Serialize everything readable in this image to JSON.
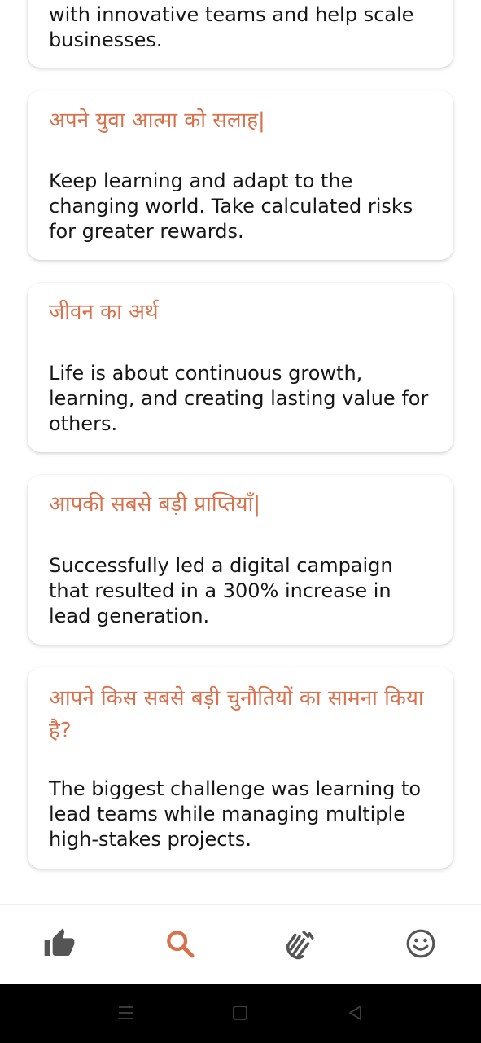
{
  "cards": [
    {
      "title": "",
      "body": "with innovative teams and help scale businesses."
    },
    {
      "title": "अपने युवा आत्मा को सलाह|",
      "body": "Keep learning and adapt to the changing world. Take calculated risks for greater rewards."
    },
    {
      "title": "जीवन का अर्थ",
      "body": "Life is about continuous growth, learning, and creating lasting value for others."
    },
    {
      "title": "आपकी सबसे बड़ी प्राप्तियाँ|",
      "body": "Successfully led a digital campaign that resulted in a 300% increase in lead generation."
    },
    {
      "title": "आपने किस सबसे बड़ी चुनौतियों का सामना किया है?",
      "body": "The biggest challenge was learning to lead teams while managing multiple high-stakes projects."
    }
  ],
  "nav": {
    "items": [
      {
        "icon": "thumbs-up-icon",
        "active": false
      },
      {
        "icon": "search-icon",
        "active": true
      },
      {
        "icon": "clapping-hands-icon",
        "active": false
      },
      {
        "icon": "smiley-face-icon",
        "active": false
      }
    ],
    "active_color": "#d9714d",
    "inactive_color": "#555555"
  },
  "colors": {
    "title": "#d9714d",
    "body": "#161616",
    "system_bar": "#000000"
  },
  "system_nav": {
    "items": [
      "menu-icon",
      "home-icon",
      "back-icon"
    ]
  }
}
